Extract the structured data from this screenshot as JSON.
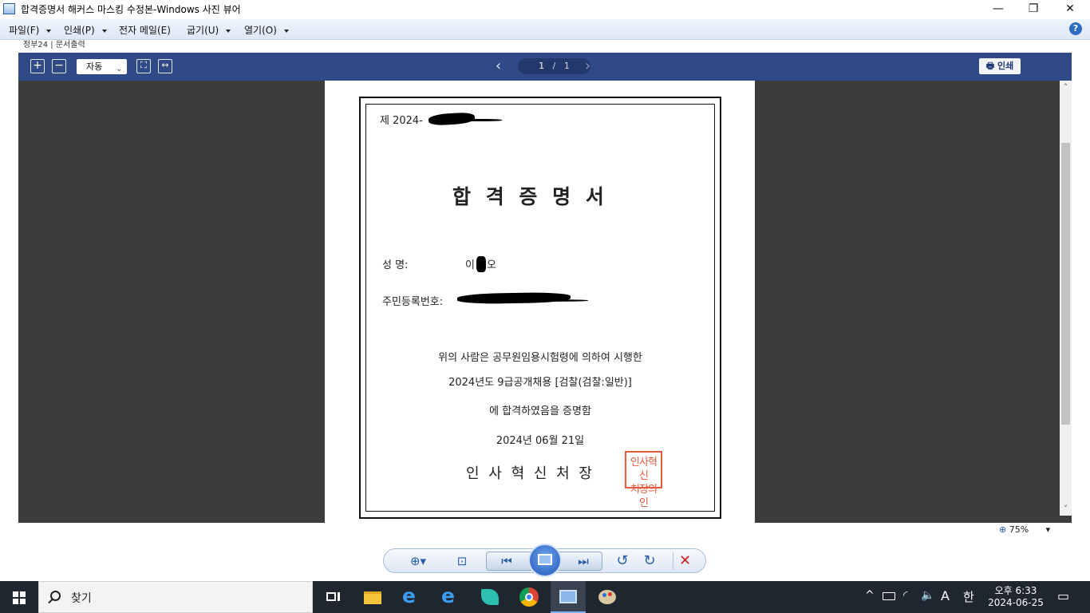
{
  "window": {
    "title": "합격증명서 해커스 마스킹 수정본-Windows 사진 뷰어",
    "minimize": "—",
    "restore": "❐",
    "close": "✕"
  },
  "menu": {
    "items": [
      {
        "label": "파일(F)"
      },
      {
        "label": "인쇄(P)"
      },
      {
        "label": "전자 메일(E)"
      },
      {
        "label": "굽기(U)"
      },
      {
        "label": "열기(O)"
      }
    ],
    "help": "?"
  },
  "strip": {
    "text": "정부24 | 문서출력"
  },
  "pdf_toolbar": {
    "zoom_in": "+",
    "zoom_out": "−",
    "zoom_mode": "자동",
    "zoom_caret": "⌄",
    "fit_page": "⛶",
    "fit_width": "↔",
    "prev": "‹",
    "current_page": "1",
    "page_separator": "/",
    "total_pages": "1",
    "next": "›",
    "print_icon": "🖶",
    "print_label": "인쇄"
  },
  "certificate": {
    "number_prefix": "제 2024-",
    "title": "합 격 증 명 서",
    "name_label": "성          명:",
    "name_value_start": "이",
    "name_value_end": "오",
    "id_label": "주민등록번호:",
    "body_line1": "위의 사람은 공무원임용시험령에 의하여 시행한",
    "body_line2": "2024년도 9급공개채용 [검찰(검찰:일반)]",
    "body_line3": "에 합격하였음을 증명함",
    "date": "2024년 06월 21일",
    "issuer": "인 사 혁 신 처 장",
    "seal_line1": "인사혁신",
    "seal_line2": "처장의인"
  },
  "scrollbar": {
    "up": "˄",
    "down": "˅"
  },
  "status": {
    "zoom": "75%",
    "zoom_caret": "▾"
  },
  "controls": {
    "zoom": "⊕▾",
    "actual_size": "⊡",
    "previous": "⏮",
    "next": "⏭",
    "rotate_left": "↺",
    "rotate_right": "↻",
    "delete": "✕"
  },
  "taskbar": {
    "search_placeholder": "찾기",
    "tray_caret": "^",
    "tray_ime_mode": "A",
    "tray_ime_lang": "한",
    "clock_time": "오후 6:33",
    "clock_date": "2024-06-25",
    "notification": "▭"
  },
  "colors": {
    "toolbar_bg": "#2f4a87",
    "viewer_bg": "#3c3c3c",
    "seal_red": "#e65b3c",
    "taskbar_bg": "#202630"
  }
}
